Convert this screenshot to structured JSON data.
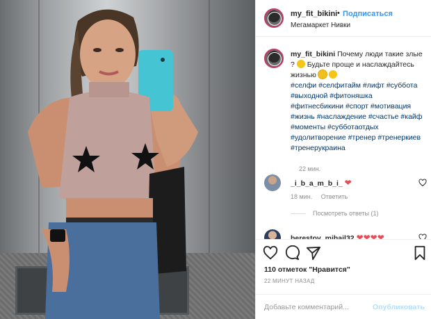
{
  "post": {
    "image": {
      "icon": "elevator-selfie-photo"
    },
    "header": {
      "username": "my_fit_bikini",
      "separator": "•",
      "follow_label": "Подписаться",
      "location": "Мегамаркет Нивки"
    },
    "caption": {
      "username": "my_fit_bikini",
      "text_before": "Почему люди такие злые ?",
      "text_middle": "Будьте проще и наслаждайтесь жизнью",
      "tags": "#селфи #селфитайм #лифт #суббота #выходной #фитоняшка #фитнесбикини #спорт #мотивация #жизнь #наслаждение #счастье #кайф #моменты #субботаотдых #удолитворение #тренер #тренеркиев #тренерукраина",
      "time": "22 мин."
    },
    "comments": [
      {
        "username": "_i_b_a_m_b_i_",
        "suffix": "❤",
        "time": "18 мин.",
        "reply_label": "Ответить"
      },
      {
        "username": "berestov_mihail32",
        "suffix": "❤❤❤❤"
      }
    ],
    "view_replies_label": "Посмотреть ответы (1)",
    "likes_text": "110 отметок \"Нравится\"",
    "posted_time": "22 МИНУТ НАЗАД",
    "add_comment": {
      "placeholder": "Добавьте комментарий...",
      "publish_label": "Опубликовать"
    }
  },
  "colors": {
    "accent": "#3897f0",
    "tag": "#003569",
    "heart": "#ed4956",
    "muted": "#8e8e8e"
  }
}
